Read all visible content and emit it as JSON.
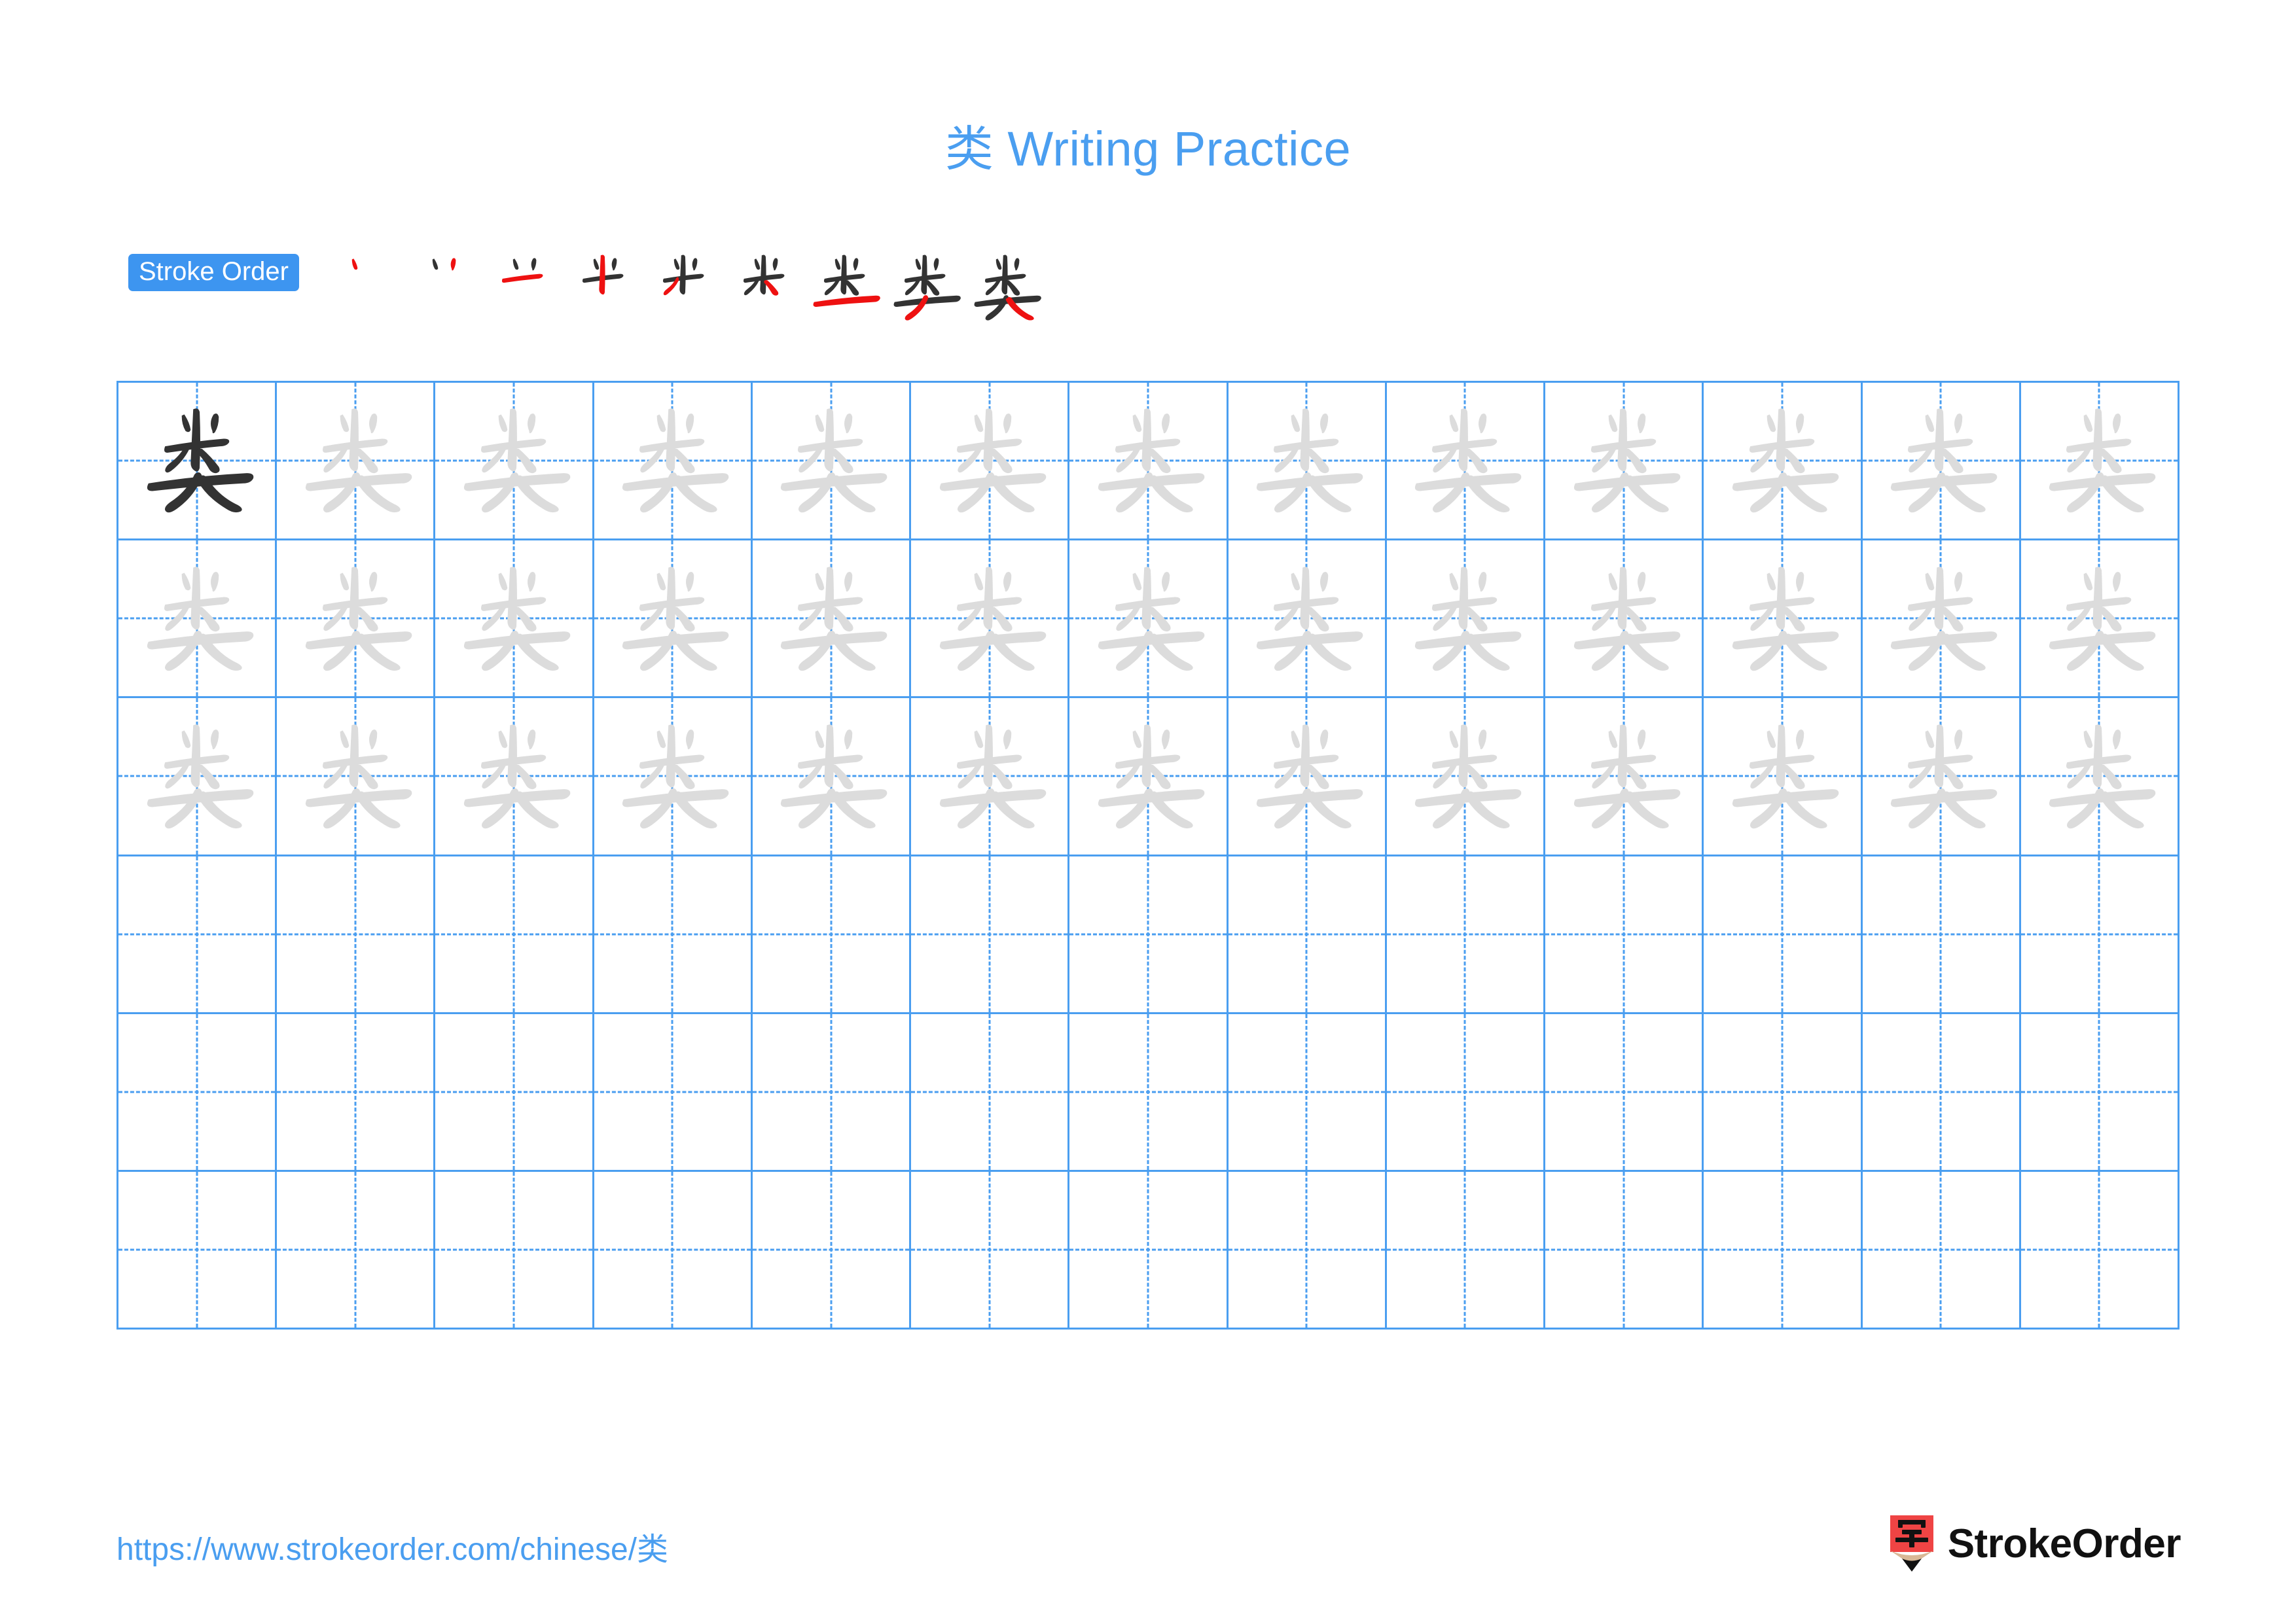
{
  "document": {
    "title": "类 Writing Practice",
    "character": "类",
    "stroke_count": 9
  },
  "stroke_order": {
    "badge_label": "Stroke Order",
    "steps": [
      {
        "index": 1,
        "strokes_shown": 1,
        "new_stroke": 1
      },
      {
        "index": 2,
        "strokes_shown": 2,
        "new_stroke": 2
      },
      {
        "index": 3,
        "strokes_shown": 3,
        "new_stroke": 3
      },
      {
        "index": 4,
        "strokes_shown": 4,
        "new_stroke": 4
      },
      {
        "index": 5,
        "strokes_shown": 5,
        "new_stroke": 5
      },
      {
        "index": 6,
        "strokes_shown": 6,
        "new_stroke": 6
      },
      {
        "index": 7,
        "strokes_shown": 7,
        "new_stroke": 7
      },
      {
        "index": 8,
        "strokes_shown": 8,
        "new_stroke": 8
      },
      {
        "index": 9,
        "strokes_shown": 9,
        "new_stroke": 9
      }
    ]
  },
  "grid": {
    "columns": 13,
    "rows": 6,
    "rows_content": [
      {
        "row": 1,
        "cells": [
          "dark",
          "light",
          "light",
          "light",
          "light",
          "light",
          "light",
          "light",
          "light",
          "light",
          "light",
          "light",
          "light"
        ]
      },
      {
        "row": 2,
        "cells": [
          "light",
          "light",
          "light",
          "light",
          "light",
          "light",
          "light",
          "light",
          "light",
          "light",
          "light",
          "light",
          "light"
        ]
      },
      {
        "row": 3,
        "cells": [
          "light",
          "light",
          "light",
          "light",
          "light",
          "light",
          "light",
          "light",
          "light",
          "light",
          "light",
          "light",
          "light"
        ]
      },
      {
        "row": 4,
        "cells": [
          "empty",
          "empty",
          "empty",
          "empty",
          "empty",
          "empty",
          "empty",
          "empty",
          "empty",
          "empty",
          "empty",
          "empty",
          "empty"
        ]
      },
      {
        "row": 5,
        "cells": [
          "empty",
          "empty",
          "empty",
          "empty",
          "empty",
          "empty",
          "empty",
          "empty",
          "empty",
          "empty",
          "empty",
          "empty",
          "empty"
        ]
      },
      {
        "row": 6,
        "cells": [
          "empty",
          "empty",
          "empty",
          "empty",
          "empty",
          "empty",
          "empty",
          "empty",
          "empty",
          "empty",
          "empty",
          "empty",
          "empty"
        ]
      }
    ]
  },
  "footer": {
    "url": "https://www.strokeorder.com/chinese/类",
    "brand": "StrokeOrder",
    "logo_character": "字"
  },
  "colors": {
    "accent_blue": "#4a9ef0",
    "badge_blue": "#3d95f0",
    "grid_blue": "#4a9ef0",
    "model_dark": "#333333",
    "trace_gray": "#dcdcdc",
    "new_stroke_red": "#ee1111",
    "logo_red": "#ef4444",
    "logo_wood": "#d9b896",
    "logo_tip": "#111111"
  }
}
